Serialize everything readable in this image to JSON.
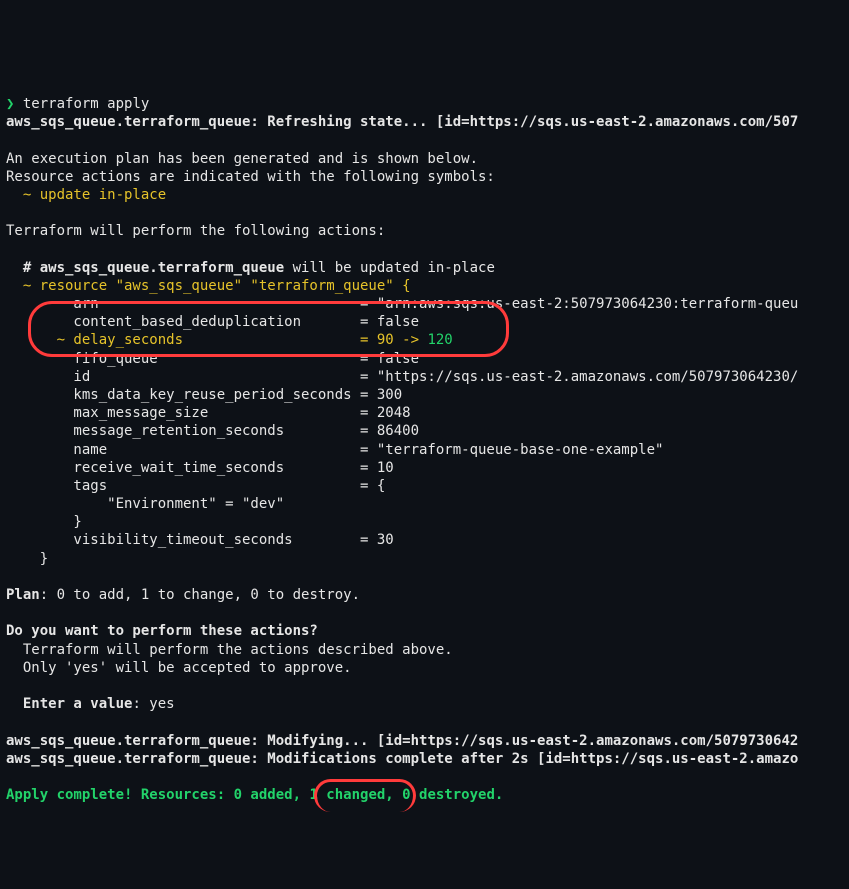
{
  "prompt": {
    "char": "❯",
    "cmd": "terraform apply"
  },
  "refresh": {
    "prefix": "aws_sqs_queue.terraform_queue: Refreshing state... ",
    "id": "[id=https://sqs.us-east-2.amazonaws.com/507"
  },
  "intro1": "An execution plan has been generated and is shown below.",
  "intro2": "Resource actions are indicated with the following symbols:",
  "sym_update": "  ~ update in-place",
  "perform": "Terraform will perform the following actions:",
  "res_header_prefix": "  # ",
  "res_header_name": "aws_sqs_queue.terraform_queue",
  "res_header_suffix": " will be updated in-place",
  "res_open": "  ~ resource \"aws_sqs_queue\" \"terraform_queue\" {",
  "attrs": {
    "arn": "        arn                               = \"arn:aws:sqs:us-east-2:507973064230:terraform-queu",
    "cbd": "        content_based_deduplication       = false",
    "delay_left": "      ~ delay_seconds                     = 90 ",
    "delay_arrow": "->",
    "delay_right": " 120",
    "fifo": "        fifo_queue                        = false",
    "id": "        id                                = \"https://sqs.us-east-2.amazonaws.com/507973064230/",
    "kms": "        kms_data_key_reuse_period_seconds = 300",
    "max": "        max_message_size                  = 2048",
    "ret": "        message_retention_seconds         = 86400",
    "name": "        name                              = \"terraform-queue-base-one-example\"",
    "rwait": "        receive_wait_time_seconds         = 10",
    "tags": "        tags                              = {",
    "tags_inner": "            \"Environment\" = \"dev\"",
    "tags_close": "        }",
    "vis": "        visibility_timeout_seconds        = 30",
    "close": "    }"
  },
  "plan_line": "Plan: 0 to add, 1 to change, 0 to destroy.",
  "confirm_q": "Do you want to perform these actions?",
  "confirm_l1": "  Terraform will perform the actions described above.",
  "confirm_l2": "  Only 'yes' will be accepted to approve.",
  "enter_label": "  Enter a value",
  "enter_value": ": yes",
  "mod1": {
    "pre": "aws_sqs_queue.terraform_queue: Modifying... ",
    "id": "[id=https://sqs.us-east-2.amazonaws.com/5079730642"
  },
  "mod2": {
    "pre": "aws_sqs_queue.terraform_queue: Modifications complete after 2s ",
    "id": "[id=https://sqs.us-east-2.amazo"
  },
  "apply": {
    "pre": "Apply complete! Resources: 0 added, ",
    "changed": "1 changed,",
    "post": " 0 destroyed."
  }
}
